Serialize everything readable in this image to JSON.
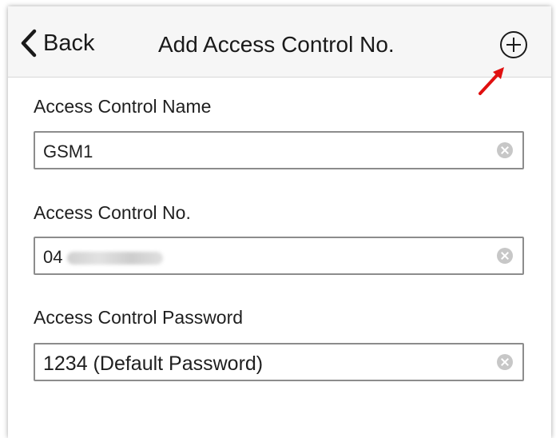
{
  "navbar": {
    "back_label": "Back",
    "title": "Add Access Control No.",
    "add_icon": "plus-circle-icon",
    "annotation_arrow_color": "#e01010"
  },
  "form": {
    "fields": [
      {
        "label": "Access Control Name",
        "value": "GSM1"
      },
      {
        "label": "Access Control No.",
        "value": "04"
      },
      {
        "label": "Access Control Password",
        "value": "1234 (Default Password)"
      }
    ],
    "clear_icon": "clear-circle-icon"
  }
}
